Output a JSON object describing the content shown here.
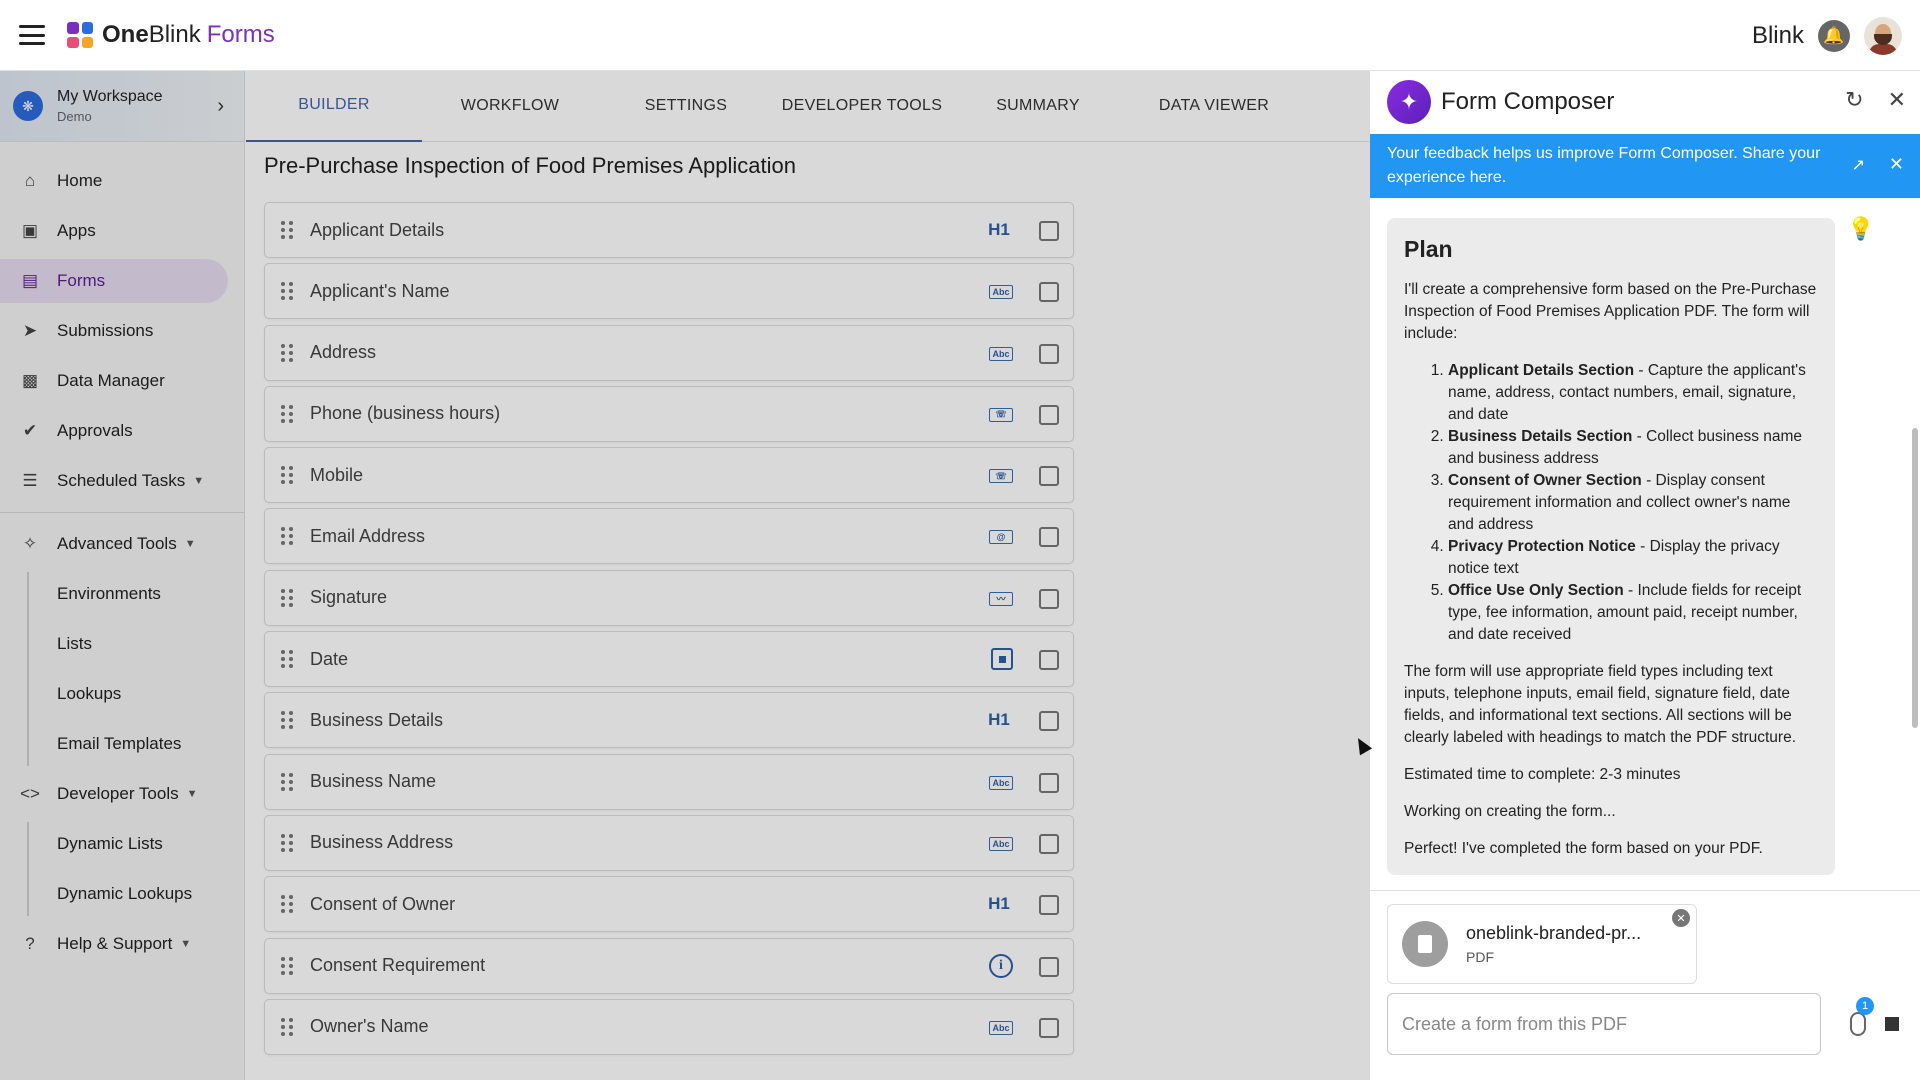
{
  "topbar": {
    "brand_one": "One",
    "brand_blink": "Blink",
    "brand_forms": "Forms",
    "user_name": "Blink"
  },
  "workspace": {
    "name": "My Workspace",
    "sub": "Demo"
  },
  "sidebar": {
    "items": [
      {
        "label": "Home",
        "icon": "home-icon"
      },
      {
        "label": "Apps",
        "icon": "devices-icon"
      },
      {
        "label": "Forms",
        "icon": "clipboard-icon",
        "active": true
      },
      {
        "label": "Submissions",
        "icon": "send-icon"
      },
      {
        "label": "Data Manager",
        "icon": "folder-icon"
      },
      {
        "label": "Approvals",
        "icon": "check-circle-icon"
      },
      {
        "label": "Scheduled Tasks",
        "icon": "checklist-icon"
      }
    ],
    "advanced_tools": {
      "label": "Advanced Tools",
      "children": [
        "Environments",
        "Lists",
        "Lookups",
        "Email Templates"
      ]
    },
    "developer_tools": {
      "label": "Developer Tools",
      "children": [
        "Dynamic Lists",
        "Dynamic Lookups"
      ]
    },
    "help": {
      "label": "Help & Support"
    }
  },
  "tabs": [
    "BUILDER",
    "WORKFLOW",
    "SETTINGS",
    "DEVELOPER TOOLS",
    "SUMMARY",
    "DATA VIEWER"
  ],
  "form": {
    "title": "Pre-Purchase Inspection of Food Premises Application",
    "elements": [
      {
        "label": "Applicant Details",
        "type": "heading",
        "type_icon": "H1"
      },
      {
        "label": "Applicant's Name",
        "type": "text",
        "type_icon": "Abc"
      },
      {
        "label": "Address",
        "type": "text",
        "type_icon": "Abc"
      },
      {
        "label": "Phone (business hours)",
        "type": "telephone",
        "type_icon": "☏"
      },
      {
        "label": "Mobile",
        "type": "telephone",
        "type_icon": "☏"
      },
      {
        "label": "Email Address",
        "type": "email",
        "type_icon": "@"
      },
      {
        "label": "Signature",
        "type": "signature",
        "type_icon": "〰"
      },
      {
        "label": "Date",
        "type": "date",
        "type_icon": ""
      },
      {
        "label": "Business Details",
        "type": "heading",
        "type_icon": "H1"
      },
      {
        "label": "Business Name",
        "type": "text",
        "type_icon": "Abc"
      },
      {
        "label": "Business Address",
        "type": "text",
        "type_icon": "Abc"
      },
      {
        "label": "Consent of Owner",
        "type": "heading",
        "type_icon": "H1"
      },
      {
        "label": "Consent Requirement",
        "type": "info",
        "type_icon": "i"
      },
      {
        "label": "Owner's Name",
        "type": "text",
        "type_icon": "Abc"
      }
    ]
  },
  "composer": {
    "title": "Form Composer",
    "feedback": "Your feedback helps us improve Form Composer. Share your experience here.",
    "plan": {
      "heading": "Plan",
      "intro": "I'll create a comprehensive form based on the Pre-Purchase Inspection of Food Premises Application PDF. The form will include:",
      "items": [
        {
          "title": "Applicant Details Section",
          "text": " - Capture the applicant's name, address, contact numbers, email, signature, and date"
        },
        {
          "title": "Business Details Section",
          "text": " - Collect business name and business address"
        },
        {
          "title": "Consent of Owner Section",
          "text": " - Display consent requirement information and collect owner's name and address"
        },
        {
          "title": "Privacy Protection Notice",
          "text": " - Display the privacy notice text"
        },
        {
          "title": "Office Use Only Section",
          "text": " - Include fields for receipt type, fee information, amount paid, receipt number, and date received"
        }
      ],
      "summary": "The form will use appropriate field types including text inputs, telephone inputs, email field, signature field, date fields, and informational text sections. All sections will be clearly labeled with headings to match the PDF structure.",
      "estimate": "Estimated time to complete: 2-3 minutes",
      "working": "Working on creating the form...",
      "done": "Perfect! I've completed the form based on your PDF."
    },
    "attachment": {
      "name": "oneblink-branded-pr...",
      "type": "PDF"
    },
    "input": {
      "placeholder": "Create a form from this PDF",
      "value": ""
    },
    "attachment_count": "1"
  }
}
